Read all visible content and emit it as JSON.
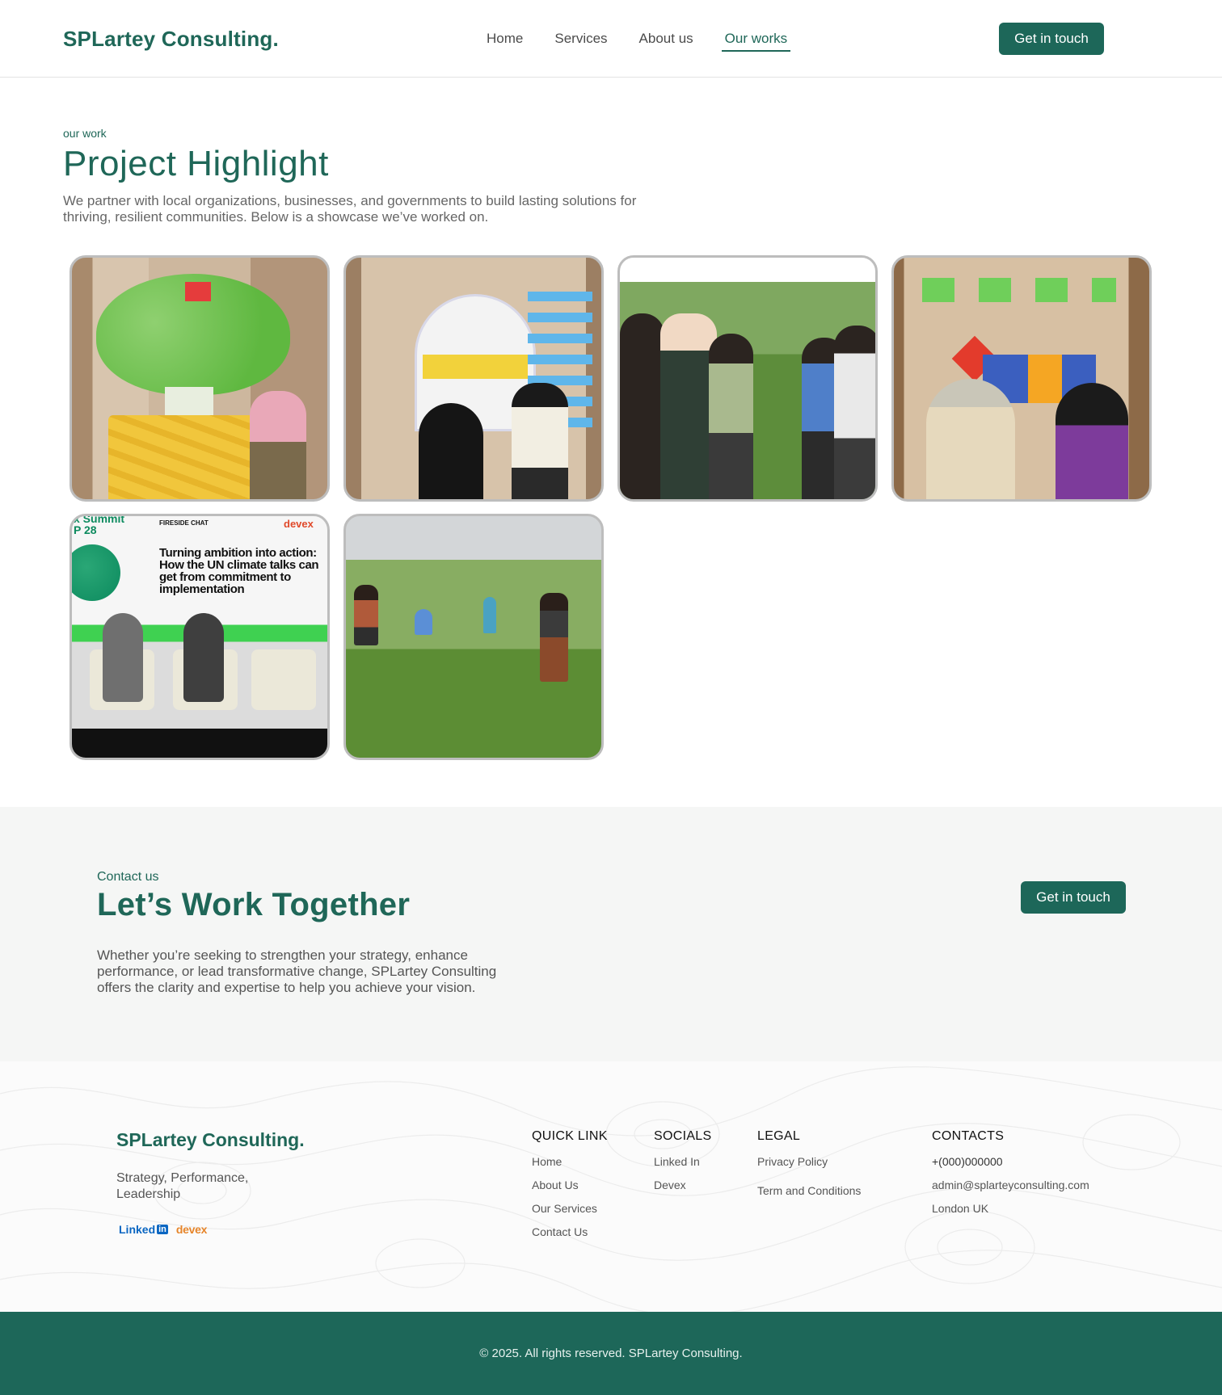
{
  "nav": {
    "logo": "SPLartey Consulting.",
    "links": [
      {
        "label": "Home"
      },
      {
        "label": "Services"
      },
      {
        "label": "About us"
      },
      {
        "label": "Our works",
        "active": true
      }
    ],
    "cta_label": "Get in touch"
  },
  "highlight": {
    "eyebrow": "our work",
    "title": "Project Highlight",
    "description": "We partner with local organizations, businesses, and governments to build lasting solutions for thriving, resilient communities. Below is a showcase we’ve worked on."
  },
  "gallery": {
    "photo5": {
      "summit": "x Summit",
      "cop": "P 28",
      "fireside": "FIRESIDE CHAT",
      "brand": "devex",
      "headline": "Turning ambition into action: How the UN climate talks can get from commitment to implementation"
    }
  },
  "cta": {
    "eyebrow": "Contact us",
    "title": "Let’s Work Together",
    "text": "Whether you’re seeking to strengthen your strategy, enhance performance, or lead transformative change, SPLartey Consulting offers the clarity and expertise to help you achieve your vision.",
    "button_label": "Get in touch"
  },
  "footer": {
    "logo": "SPLartey Consulting.",
    "tagline": "Strategy, Performance, Leadership",
    "brands": {
      "linkedin": "Linked",
      "linkedin_in": "in",
      "devex": "devex"
    },
    "quick_link": {
      "heading": "QUICK LINK",
      "items": [
        "Home",
        "About Us",
        "Our Services",
        "Contact Us"
      ]
    },
    "socials": {
      "heading": "SOCIALS",
      "items": [
        "Linked In",
        "Devex"
      ]
    },
    "legal": {
      "heading": "LEGAL",
      "items": [
        "Privacy Policy",
        "Term and Conditions"
      ]
    },
    "contacts": {
      "heading": "CONTACTS",
      "items": [
        "+(000)000000",
        "admin@splarteyconsulting.com",
        "London UK"
      ]
    },
    "copyright": "© 2025. All rights reserved. SPLartey Consulting."
  },
  "colors": {
    "brand_green": "#1d6759",
    "accent_green": "#1f6758"
  }
}
